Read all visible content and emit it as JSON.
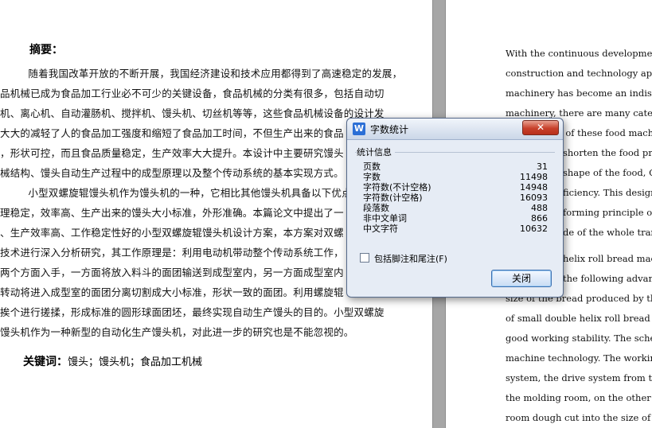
{
  "left_page": {
    "abstract_title": "摘要：",
    "lines": [
      "　　随着我国改革开放的不断开展，我国经济建设和技术应用都得到了高速稳定的发展，",
      "品机械已成为食品加工行业必不可少的关键设备，食品机械的分类有很多，包括自动切",
      "机、离心机、自动灌肠机、搅拌机、馒头机、切丝机等等，这些食品机械设备的设计发",
      "大大的减轻了人的食品加工强度和缩短了食品加工时间，不但生产出来的食品",
      "，形状可控，而且食品质量稳定，生产效率大大提升。本设计中主要研究馒头",
      "械结构、馒头自动生产过程中的成型原理以及整个传动系统的基本实现方式。",
      "　　小型双螺旋辊馒头机作为馒头机的一种，它相比其他馒头机具备以下优点：",
      "理稳定，效率高、生产出来的馒头大小标准，外形准确。本篇论文中提出了一",
      "、生产效率高、工作稳定性好的小型双螺旋辊馒头机设计方案，本方案对双螺",
      "技术进行深入分析研究，其工作原理是：利用电动机带动整个传动系统工作，",
      "两个方面入手，一方面将放入料斗的面团输送到成型室内，另一方面成型室内",
      "转动将进入成型室的面团分离切割成大小标准，形状一致的面团。利用螺旋辊",
      "挨个进行搓揉，形成标准的圆形球面团坯，最终实现自动生产馒头的目的。小型双螺旋",
      "馒头机作为一种新型的自动化生产馒头机，对此进一步的研究也是不能忽视的。"
    ],
    "keywords_label": "关键词：",
    "keywords": "馒头；馒头机；食品加工机械"
  },
  "right_page": {
    "lines": [
      "With  the  continuous  development",
      "construction and technology applic",
      "machinery  has  become  an  indispe",
      "machinery, there are many categor",
      "l of these food machine",
      "shorten the food proc",
      "shape of the food, Co",
      "ficiency. This design",
      "forming principle of",
      "de of the whole transm",
      "helix roll bread mac",
      "the following advanta",
      "size of the bread produced by the st",
      "of small double helix roll bread m",
      "good working stability. The schen",
      "machine technology. The working",
      "system, the drive system from two a",
      "the molding room, on the other ha",
      "room dough cut into the size of th"
    ]
  },
  "dialog": {
    "app_icon": "W",
    "title": "字数统计",
    "close_label": "✕",
    "group_title": "统计信息",
    "stats": [
      {
        "label": "页数",
        "value": "31"
      },
      {
        "label": "字数",
        "value": "11498"
      },
      {
        "label": "字符数(不计空格)",
        "value": "14948"
      },
      {
        "label": "字符数(计空格)",
        "value": "16093"
      },
      {
        "label": "段落数",
        "value": "488"
      },
      {
        "label": "非中文单词",
        "value": "866"
      },
      {
        "label": "中文字符",
        "value": "10632"
      }
    ],
    "checkbox_label": "包括脚注和尾注(F)",
    "close_button": "关闭"
  }
}
